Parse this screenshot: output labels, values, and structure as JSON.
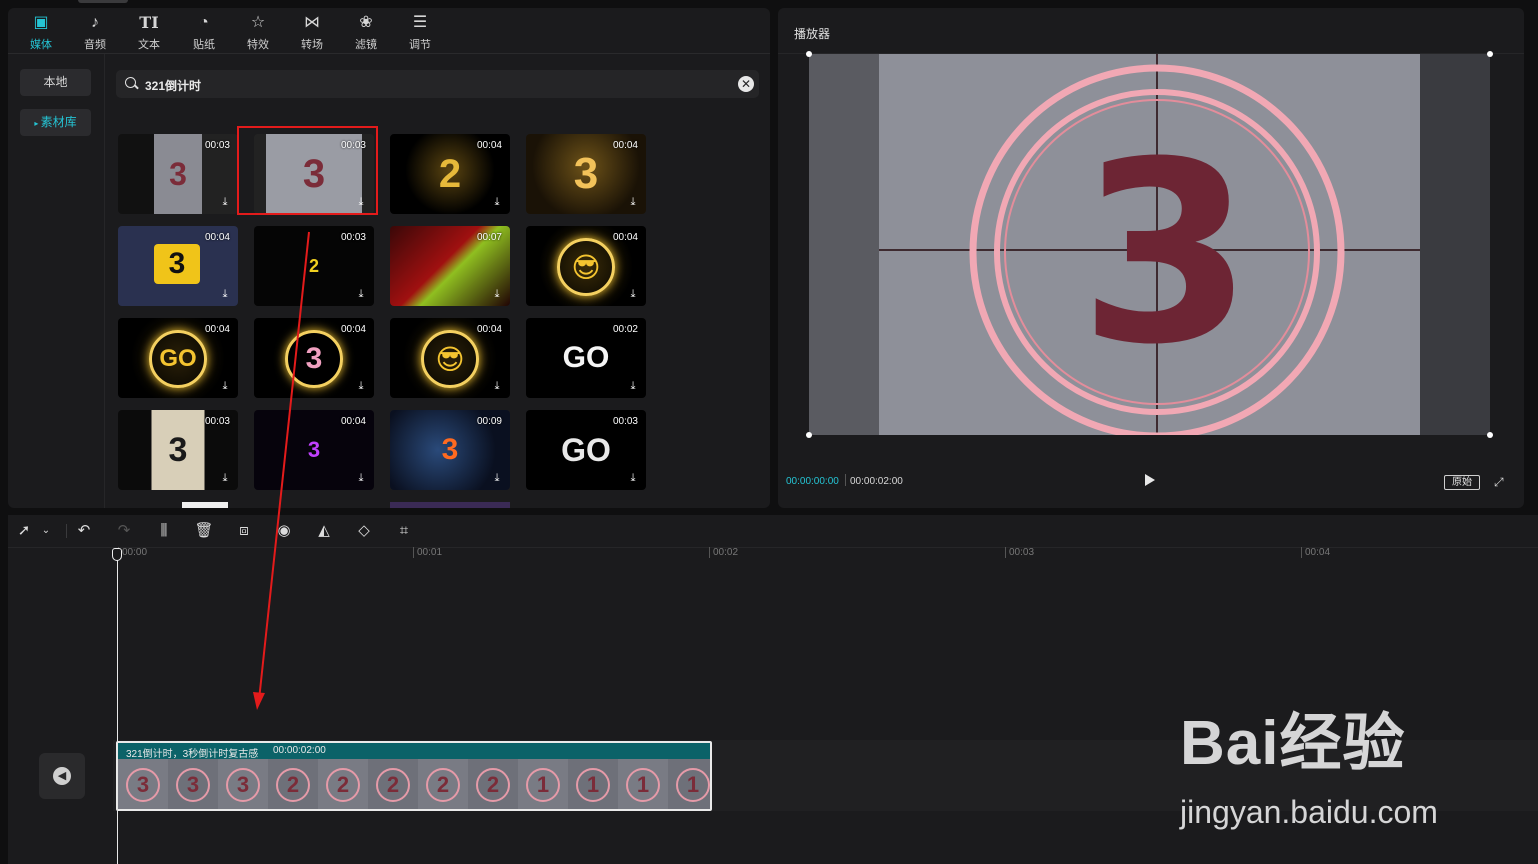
{
  "tabs": [
    {
      "label": "媒体",
      "icon": "media-icon",
      "glyph": "▣",
      "active": true
    },
    {
      "label": "音频",
      "icon": "audio-icon",
      "glyph": "♪",
      "active": false
    },
    {
      "label": "文本",
      "icon": "text-icon",
      "glyph": "TI",
      "active": false
    },
    {
      "label": "贴纸",
      "icon": "sticker-icon",
      "glyph": "◔",
      "active": false
    },
    {
      "label": "特效",
      "icon": "effects-icon",
      "glyph": "☆",
      "active": false
    },
    {
      "label": "转场",
      "icon": "transition-icon",
      "glyph": "⋈",
      "active": false
    },
    {
      "label": "滤镜",
      "icon": "filter-icon",
      "glyph": "❀",
      "active": false
    },
    {
      "label": "调节",
      "icon": "adjust-icon",
      "glyph": "☰",
      "active": false
    }
  ],
  "sidebar": {
    "local": "本地",
    "library": "素材库"
  },
  "search": {
    "value": "321倒计时",
    "clear_glyph": "✕"
  },
  "thumbnails": [
    {
      "dur": "00:03",
      "art": "3",
      "style": "film"
    },
    {
      "dur": "00:03",
      "art": "3",
      "style": "film-wide"
    },
    {
      "dur": "00:04",
      "art": "2",
      "style": "gold-dust"
    },
    {
      "dur": "00:04",
      "art": "3",
      "style": "gold"
    },
    {
      "dur": "00:04",
      "art": "3",
      "style": "cinema"
    },
    {
      "dur": "00:03",
      "art": "2",
      "style": "yellow-small"
    },
    {
      "dur": "00:07",
      "art": "",
      "style": "red-abstract"
    },
    {
      "dur": "00:04",
      "art": "😎",
      "style": "ring-emoji"
    },
    {
      "dur": "00:04",
      "art": "GO",
      "style": "ring-go"
    },
    {
      "dur": "00:04",
      "art": "3",
      "style": "ring-3"
    },
    {
      "dur": "00:04",
      "art": "😎",
      "style": "ring-emoji2"
    },
    {
      "dur": "00:02",
      "art": "GO",
      "style": "go-white"
    },
    {
      "dur": "00:03",
      "art": "3",
      "style": "film-strip"
    },
    {
      "dur": "00:04",
      "art": "3",
      "style": "purple"
    },
    {
      "dur": "00:09",
      "art": "3",
      "style": "space"
    },
    {
      "dur": "00:03",
      "art": "GO",
      "style": "go-blur"
    }
  ],
  "player": {
    "title": "播放器",
    "digit": "3",
    "time_current": "00:00:00:00",
    "time_total": "00:00:02:00",
    "original_label": "原始"
  },
  "timeline": {
    "ruler": [
      "00:00",
      "00:01",
      "00:02",
      "00:03",
      "00:04"
    ],
    "clip_label": "321倒计时，3秒倒计时复古感",
    "clip_duration": "00:00:02:00",
    "frame_digits": [
      "3",
      "3",
      "3",
      "2",
      "2",
      "2",
      "2",
      "2",
      "1",
      "1",
      "1",
      "1"
    ]
  },
  "toolbar_icons": [
    "select-icon",
    "undo-icon",
    "redo-icon",
    "split-icon",
    "delete-icon",
    "freeze-icon",
    "speed-icon",
    "mirror-icon",
    "rotate-icon",
    "crop-icon"
  ],
  "watermark": {
    "main": "Bai经验",
    "sub": "jingyan.baidu.com"
  },
  "colors": {
    "accent": "#25c4d4",
    "highlight": "#e31b1b",
    "clip": "#0b6268"
  }
}
